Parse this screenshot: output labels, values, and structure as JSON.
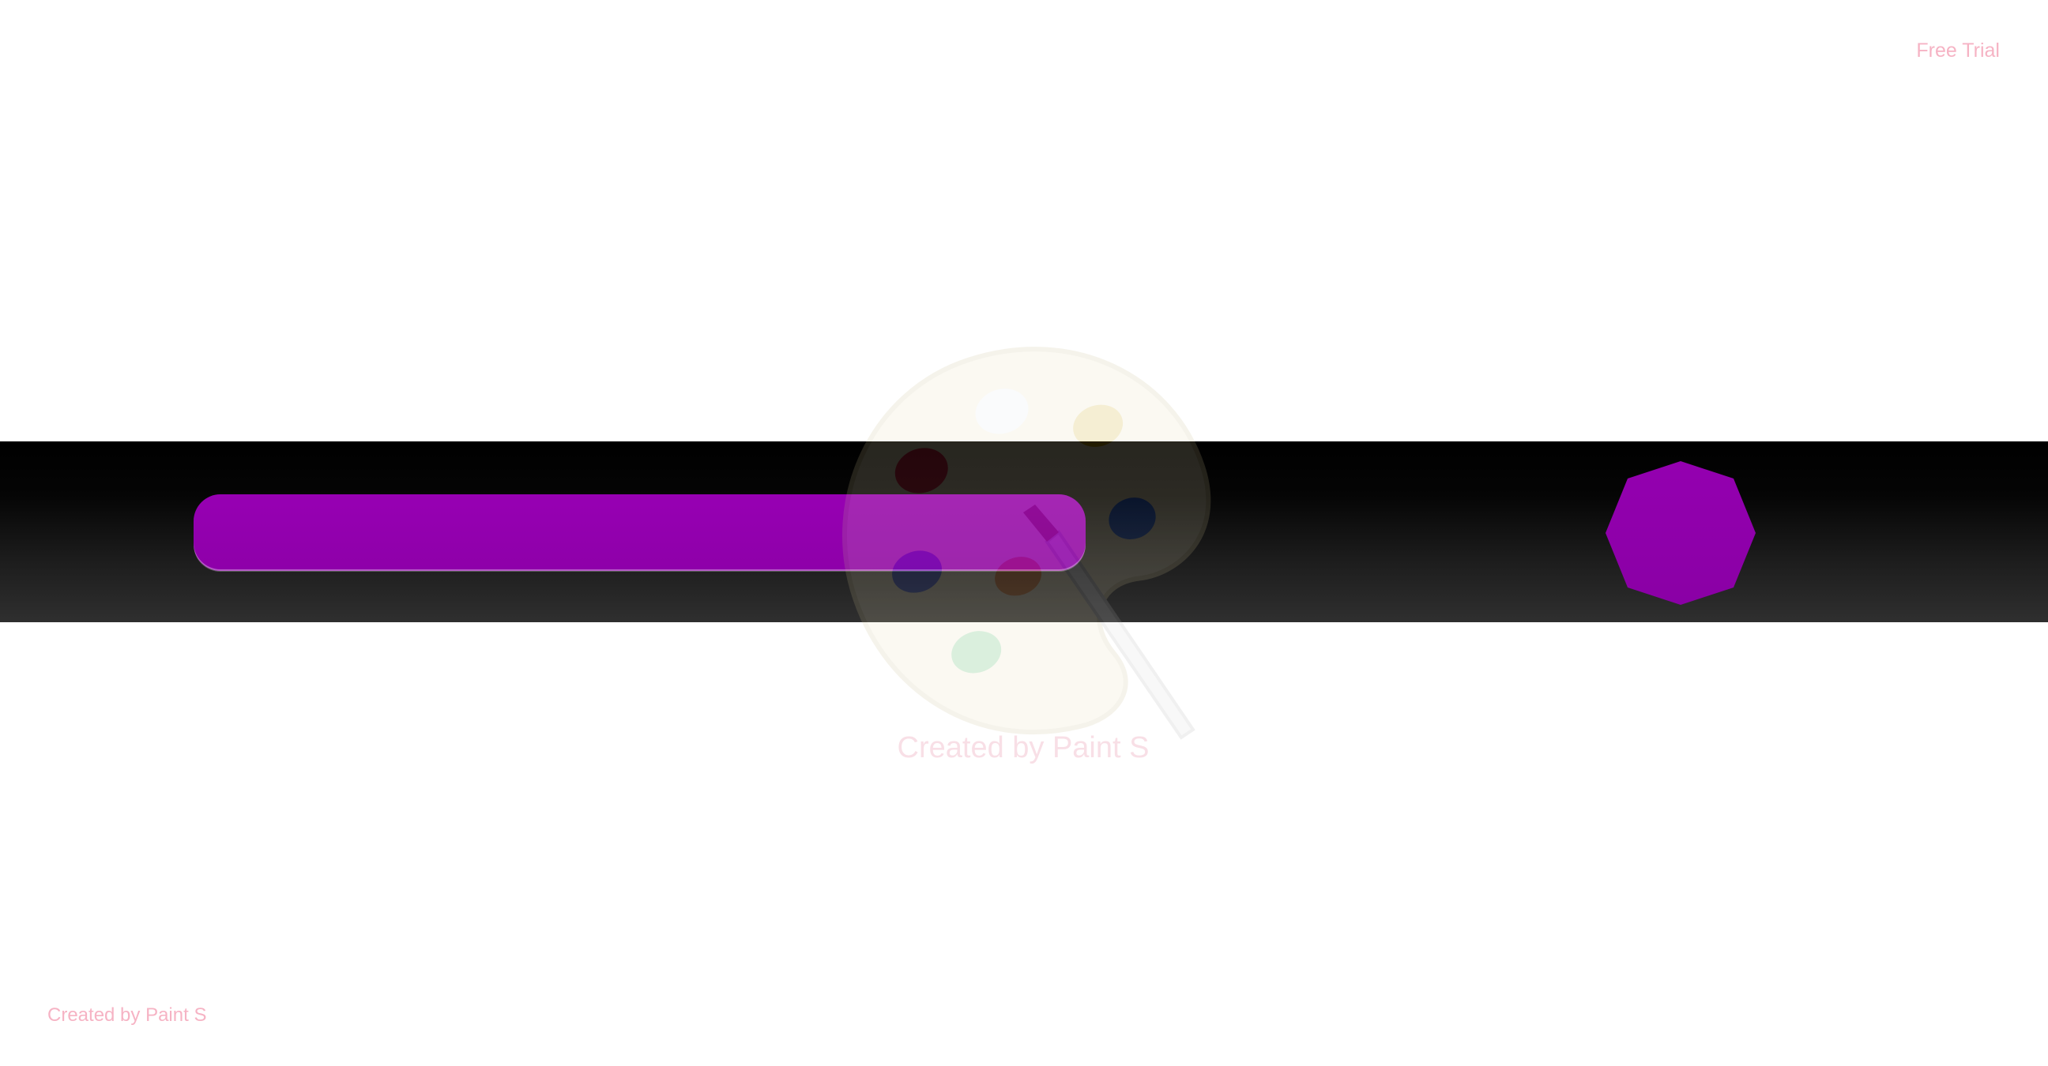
{
  "header": {
    "cta_label": "Free Trial"
  },
  "watermark": {
    "text": "Created by Paint S",
    "icon": "palette-icon"
  },
  "footer": {
    "credit": "Created by Paint S"
  },
  "colors": {
    "accent_purple": "#9100ae",
    "band_top": "#000000",
    "band_bottom": "#2f2f2f",
    "link_pink": "#f6b3c4"
  },
  "shapes": {
    "bar": "purple-rounded-bar",
    "octagon": "purple-octagon"
  }
}
